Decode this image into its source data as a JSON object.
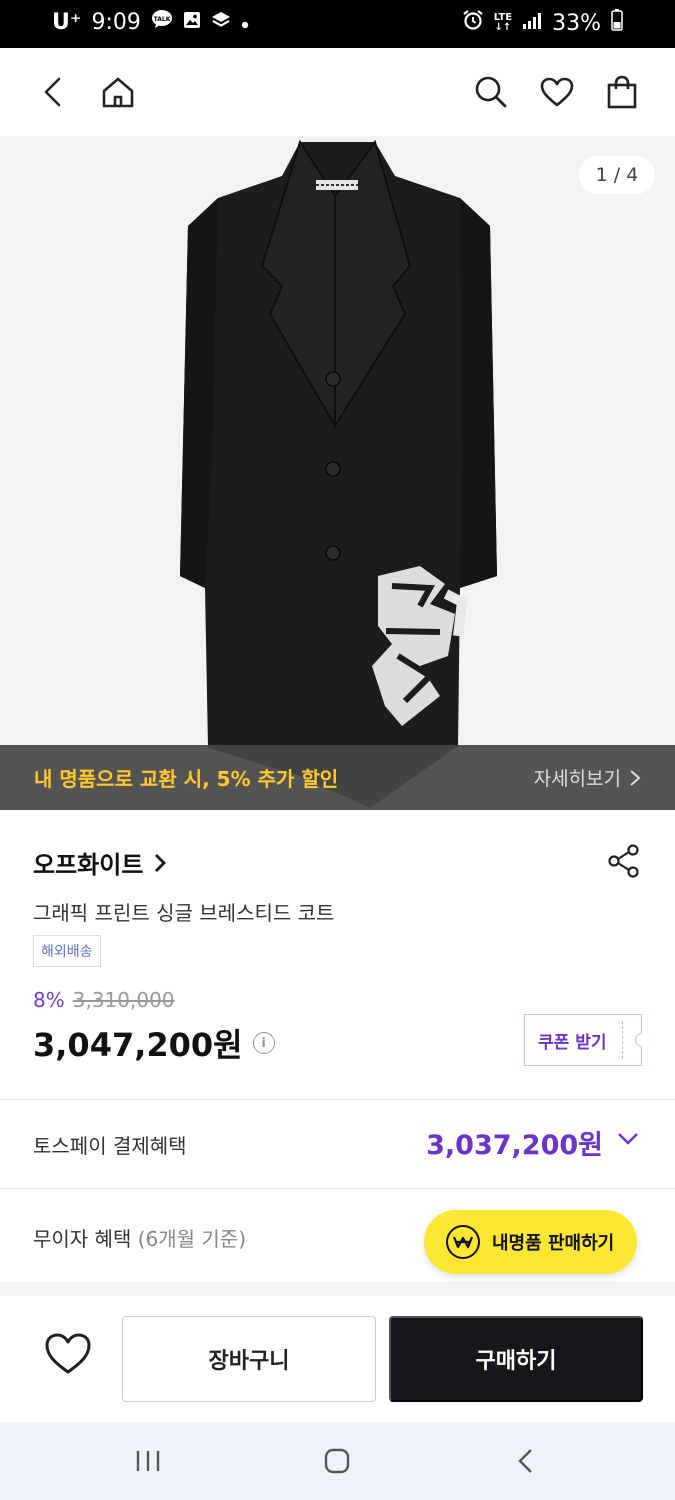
{
  "status_bar": {
    "carrier": "U⁺",
    "time": "9:09",
    "notif_icons": [
      "talk-icon",
      "image-icon",
      "layers-icon",
      "dot-icon"
    ],
    "lte": "LTE",
    "battery": "33%"
  },
  "header": {
    "icons": [
      "back-icon",
      "home-icon",
      "search-icon",
      "heart-icon",
      "shopping-bag-icon"
    ]
  },
  "gallery": {
    "counter": "1 / 4",
    "promo_text": "내 명품으로 교환 시, 5% 추가 할인",
    "promo_more": "자세히보기"
  },
  "product": {
    "brand": "오프화이트",
    "name": "그래픽 프린트 싱글 브레스티드 코트",
    "badge": "해외배송",
    "discount": "8%",
    "original_price": "3,310,000",
    "price": "3,047,200원",
    "coupon_label": "쿠폰 받기"
  },
  "benefits": {
    "toss_label": "토스페이 결제혜택",
    "toss_price": "3,037,200원",
    "installment_label": "무이자 혜택",
    "installment_sub": "(6개월 기준)",
    "sell_button": "내명품 판매하기"
  },
  "actions": {
    "cart": "장바구니",
    "buy": "구매하기"
  },
  "colors": {
    "accent_purple": "#6d33c9",
    "promo_yellow": "#ffc82c",
    "sell_yellow": "#fde732",
    "buy_black": "#16171a"
  }
}
